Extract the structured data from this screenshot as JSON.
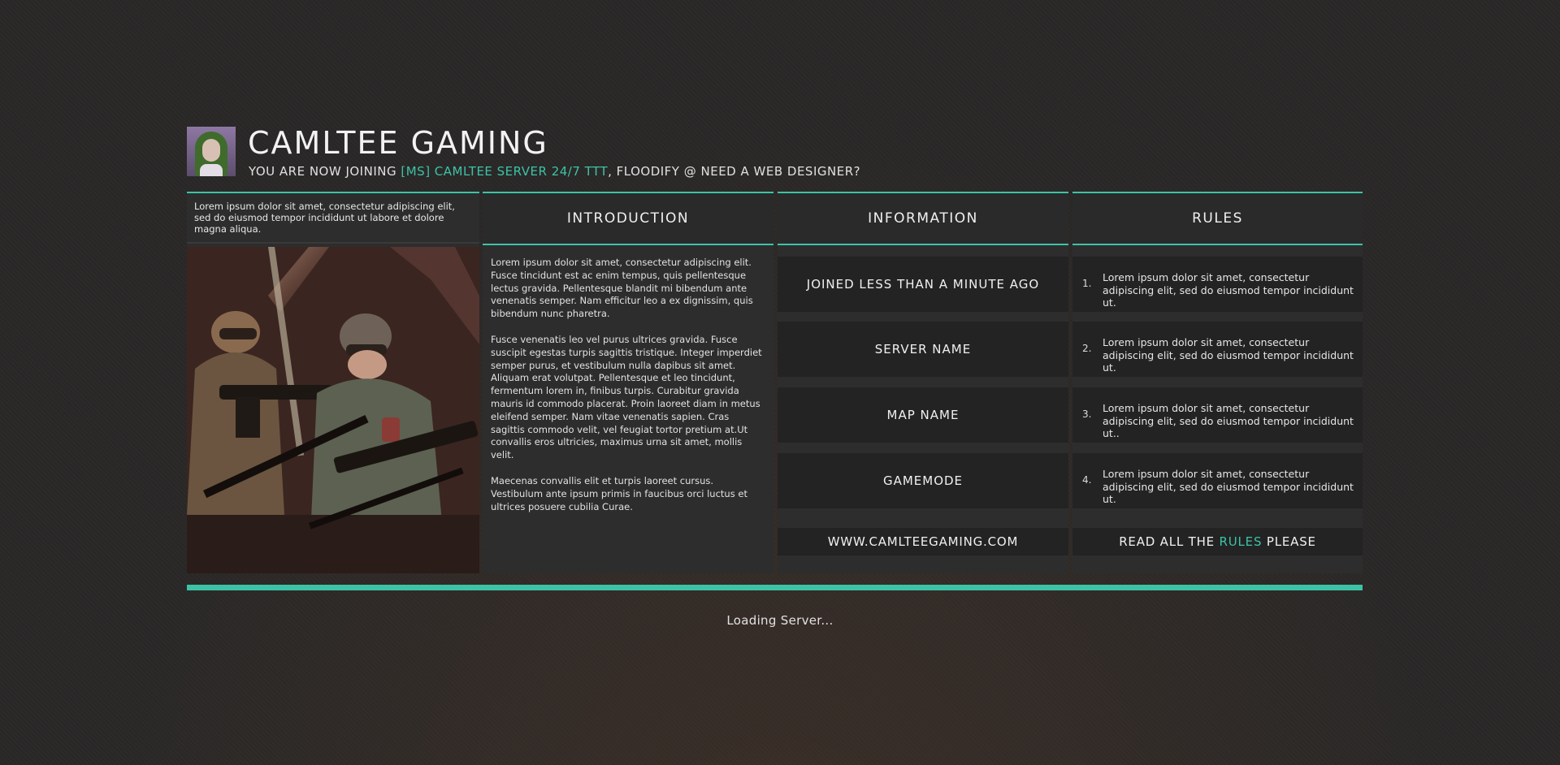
{
  "header": {
    "title": "CAMLTEE GAMING",
    "subtitle_prefix": "YOU ARE NOW JOINING ",
    "server_name": "[MS] CAMLTEE SERVER 24/7 TTT",
    "subtitle_suffix": ", FLOODIFY @ NEED A WEB DESIGNER?"
  },
  "left_panel": {
    "blurb": "Lorem ipsum dolor sit amet, consectetur adipiscing elit, sed do eiusmod tempor incididunt ut labore et dolore magna aliqua."
  },
  "introduction": {
    "heading": "INTRODUCTION",
    "paragraphs": [
      "Lorem ipsum dolor sit amet, consectetur adipiscing elit. Fusce tincidunt est ac enim tempus, quis pellentesque lectus gravida. Pellentesque blandit mi bibendum ante venenatis semper. Nam efficitur leo a ex dignissim, quis bibendum nunc pharetra.",
      "Fusce venenatis leo vel purus ultrices gravida. Fusce suscipit egestas turpis sagittis tristique. Integer imperdiet semper purus, et vestibulum nulla dapibus sit amet. Aliquam erat volutpat. Pellentesque et leo tincidunt, fermentum lorem in, finibus turpis. Curabitur gravida mauris id commodo placerat. Proin laoreet diam in metus eleifend semper. Nam vitae venenatis sapien. Cras sagittis commodo velit, vel feugiat tortor pretium at.Ut convallis eros ultricies, maximus urna sit amet, mollis velit.",
      "Maecenas convallis elit et turpis laoreet cursus. Vestibulum ante ipsum primis in faucibus orci luctus et ultrices posuere cubilia Curae."
    ]
  },
  "information": {
    "heading": "INFORMATION",
    "items": [
      "JOINED LESS THAN A MINUTE AGO",
      "SERVER NAME",
      "MAP NAME",
      "GAMEMODE"
    ],
    "website": "WWW.CAMLTEEGAMING.COM"
  },
  "rules": {
    "heading": "RULES",
    "items": [
      {
        "num": "1.",
        "text": "Lorem ipsum dolor sit amet, consectetur adipiscing elit, sed do eiusmod tempor incididunt ut."
      },
      {
        "num": "2.",
        "text": "Lorem ipsum dolor sit amet, consectetur adipiscing elit, sed do eiusmod tempor incididunt ut."
      },
      {
        "num": "3.",
        "text": "Lorem ipsum dolor sit amet, consectetur adipiscing elit, sed do eiusmod tempor incididunt ut.."
      },
      {
        "num": "4.",
        "text": "Lorem ipsum dolor sit amet, consectetur adipiscing elit, sed do eiusmod tempor incididunt ut."
      }
    ],
    "footer_prefix": "READ ALL THE ",
    "footer_accent": "RULES",
    "footer_suffix": " PLEASE"
  },
  "loading": {
    "progress_fraction": 1.0,
    "status": "Loading Server..."
  },
  "colors": {
    "accent": "#3cc3a6",
    "background": "#2a2827",
    "panel": "#2e2d2d",
    "tile": "#232324"
  }
}
